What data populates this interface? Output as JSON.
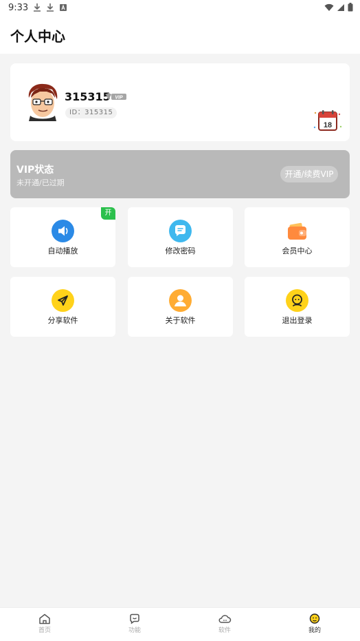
{
  "status_bar": {
    "time": "9:33"
  },
  "app_bar": {
    "title": "个人中心"
  },
  "profile": {
    "username": "315315",
    "vip_tag": "VIP",
    "id_text": "ID：315315",
    "calendar_number": "18"
  },
  "vip": {
    "title": "VIP状态",
    "subtitle": "未开通/已过期",
    "button_label": "开通/续费VIP"
  },
  "tiles": [
    {
      "label": "自动播放",
      "icon": "speaker-icon",
      "color": "#2b8ae6",
      "badge": "开"
    },
    {
      "label": "修改密码",
      "icon": "chat-icon",
      "color": "#3fb8ee"
    },
    {
      "label": "会员中心",
      "icon": "wallet-icon",
      "color": "#ff8a3d"
    },
    {
      "label": "分享软件",
      "icon": "paper-plane-icon",
      "color": "#ffd21a"
    },
    {
      "label": "关于软件",
      "icon": "person-icon",
      "color": "#ffac33"
    },
    {
      "label": "退出登录",
      "icon": "face-icon",
      "color": "#ffd21a"
    }
  ],
  "bottom_nav": [
    {
      "label": "首页",
      "icon": "home-icon"
    },
    {
      "label": "功能",
      "icon": "message-icon"
    },
    {
      "label": "软件",
      "icon": "cloud-icon"
    },
    {
      "label": "我的",
      "icon": "smile-icon",
      "active": true
    }
  ]
}
